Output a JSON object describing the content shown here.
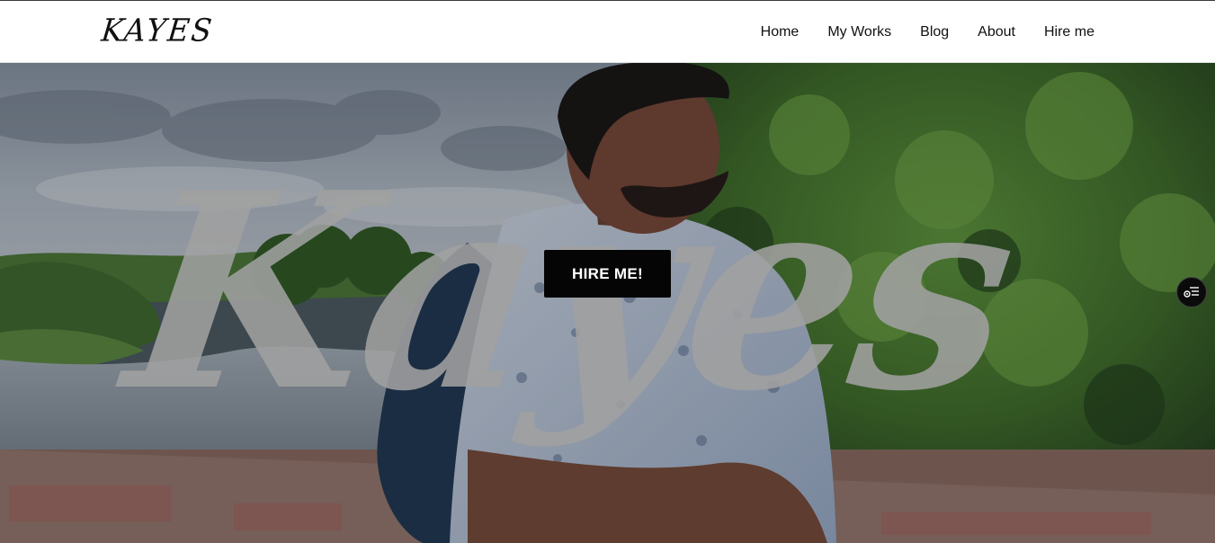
{
  "header": {
    "logo_text": "KAYES",
    "nav": [
      {
        "label": "Home"
      },
      {
        "label": "My Works"
      },
      {
        "label": "Blog"
      },
      {
        "label": "About"
      },
      {
        "label": "Hire me"
      }
    ]
  },
  "hero": {
    "script_title": "Kayes",
    "cta_label": "HIRE ME!",
    "background": "photo of a man with backpack standing by a river with green trees and cloudy sky"
  },
  "side_toggle": {
    "icon": "settings-list-icon"
  },
  "colors": {
    "nav_text": "#111111",
    "button_bg": "#050505",
    "button_text": "#ffffff",
    "script_overlay": "#a0a0a0"
  }
}
